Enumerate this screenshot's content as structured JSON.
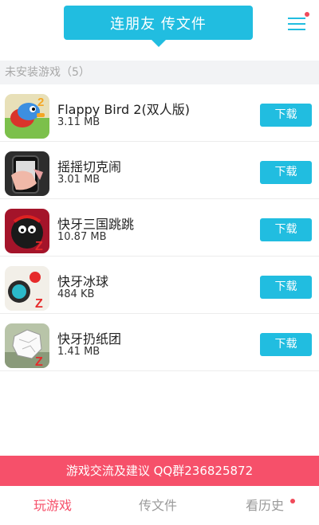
{
  "header": {
    "connect_label": "连朋友 传文件",
    "menu_icon": "hamburger-menu-icon",
    "accent_color": "#21bde0",
    "notification_dot_color": "#f04a5a"
  },
  "section": {
    "title": "未安装游戏（5）"
  },
  "apps": [
    {
      "name": "Flappy Bird 2(双人版)",
      "size": "3.11 MB",
      "button": "下载",
      "icon": "flappy-bird-icon"
    },
    {
      "name": "摇摇切克闹",
      "size": "3.01 MB",
      "button": "下载",
      "icon": "shake-phone-icon"
    },
    {
      "name": "快牙三国跳跳",
      "size": "10.87 MB",
      "button": "下载",
      "icon": "three-kingdoms-icon"
    },
    {
      "name": "快牙冰球",
      "size": "484 KB",
      "button": "下载",
      "icon": "ice-hockey-icon"
    },
    {
      "name": "快牙扔纸团",
      "size": "1.41 MB",
      "button": "下载",
      "icon": "paper-toss-icon"
    }
  ],
  "banner": {
    "text": "游戏交流及建议 QQ群236825872",
    "color": "#f6506a"
  },
  "tabs": [
    {
      "label": "玩游戏",
      "active": true
    },
    {
      "label": "传文件",
      "active": false
    },
    {
      "label": "看历史",
      "active": false
    }
  ]
}
